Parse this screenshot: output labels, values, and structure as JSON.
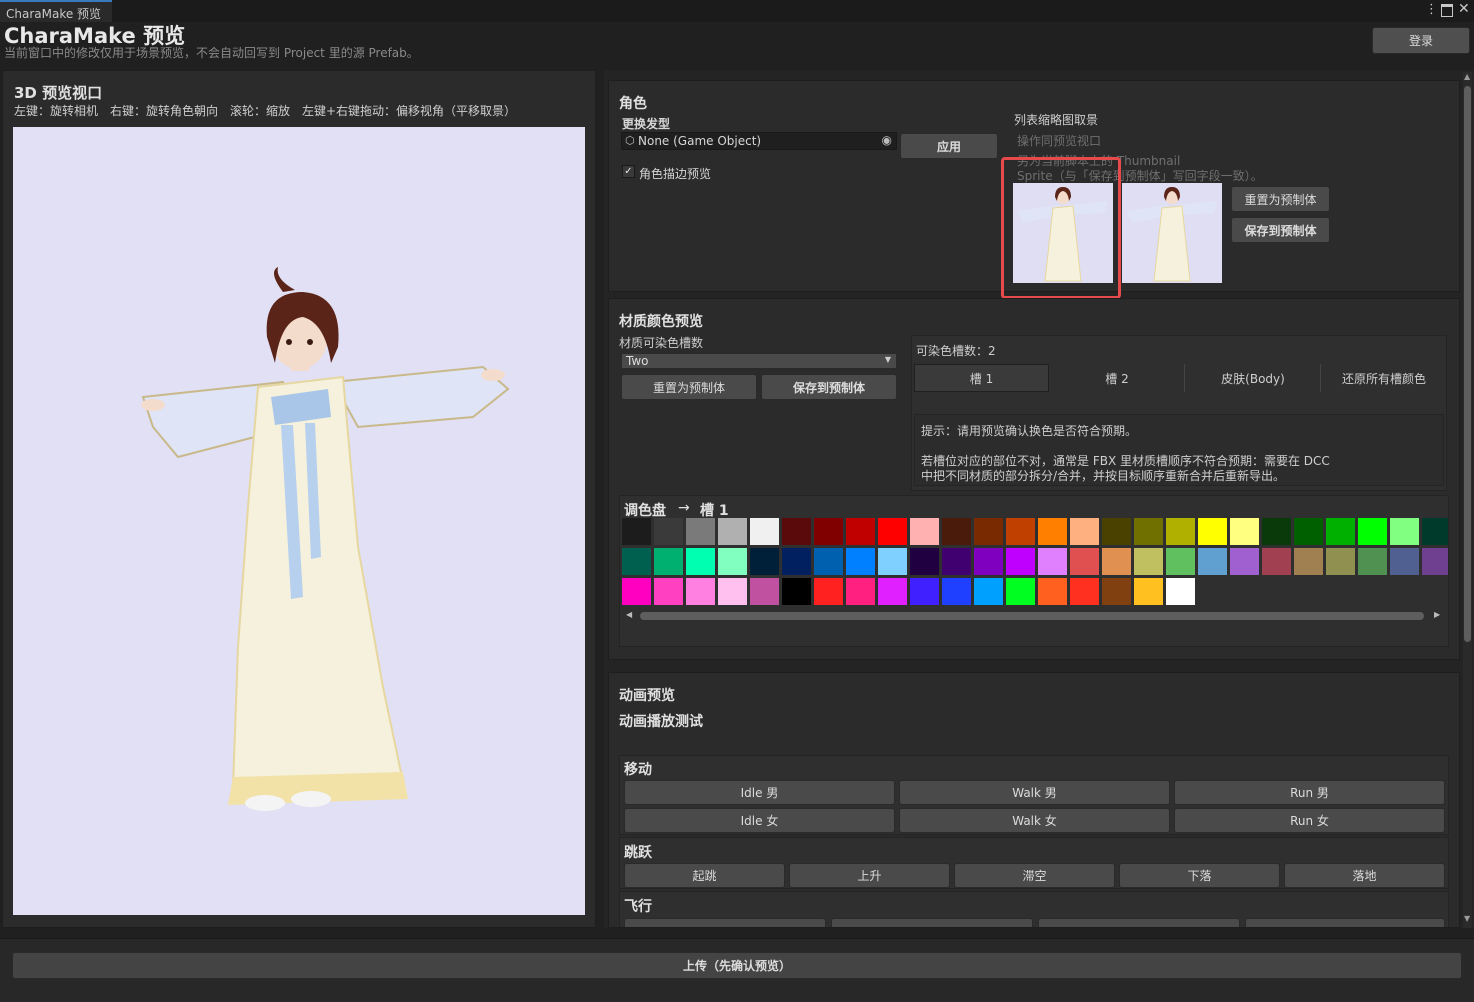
{
  "window": {
    "tab_title": "CharaMake 预览",
    "title": "CharaMake 预览",
    "subtitle": "当前窗口中的修改仅用于场景预览，不会自动回写到 Project 里的源 Prefab。",
    "login_label": "登录"
  },
  "viewport": {
    "title": "3D 预览视口",
    "hint": "左键：旋转相机　右键：旋转角色朝向　滚轮：缩放　左键+右键拖动：偏移视角（平移取景）"
  },
  "character": {
    "title": "角色",
    "hair_label": "更换发型",
    "hair_field_value": "None (Game Object)",
    "apply_label": "应用",
    "outline_label": "角色描边预览",
    "outline_checked": true,
    "thumb_title": "列表缩略图取景",
    "thumb_note1": "操作同预览视口",
    "thumb_note2": "另为当前脚本上的 Thumbnail",
    "thumb_note3": "Sprite（与「保存到预制体」写回字段一致）。",
    "reset_label": "重置为预制体",
    "save_label": "保存到预制体"
  },
  "material": {
    "title": "材质颜色预览",
    "slots_label": "材质可染色槽数",
    "slots_value": "Two",
    "reset_label": "重置为预制体",
    "save_label": "保存到预制体",
    "slot_count_text": "可染色槽数：2",
    "tabs": [
      "槽 1",
      "槽 2",
      "皮肤(Body)",
      "还原所有槽颜色"
    ],
    "tip1": "提示：请用预览确认换色是否符合预期。",
    "tip2": "若槽位对应的部位不对，通常是 FBX 里材质槽顺序不符合预期：需要在 DCC",
    "tip3": "中把不同材质的部分拆分/合并，并按目标顺序重新合并后重新导出。",
    "palette_title": "调色盘",
    "palette_target": "槽 1"
  },
  "palette": {
    "row1": [
      "#1c1c1c",
      "#3a3a3a",
      "#7a7a7a",
      "#b0b0b0",
      "#f0f0f0",
      "#5a0a0a",
      "#800000",
      "#c00000",
      "#ff0000",
      "#ffb0b0",
      "#4a1a0a",
      "#7a2a00",
      "#c04000",
      "#ff8000",
      "#ffb080",
      "#4a4000",
      "#707000",
      "#b0b000",
      "#ffff00",
      "#ffff80",
      "#0a3a0a",
      "#006000",
      "#00b000",
      "#00ff00",
      "#80ff80",
      "#003a2a"
    ],
    "row2": [
      "#006050",
      "#00b070",
      "#00ffb0",
      "#80ffc0",
      "#00203a",
      "#002060",
      "#0060b0",
      "#0080ff",
      "#80d0ff",
      "#200040",
      "#400070",
      "#8000c0",
      "#c000ff",
      "#e080ff",
      "#e05050",
      "#e09050",
      "#c0c060",
      "#60c060",
      "#60a0d0",
      "#a060d0",
      "#a04050",
      "#a08050",
      "#909050",
      "#509050",
      "#506090",
      "#704090"
    ],
    "row3": [
      "#ff00c0",
      "#ff40c0",
      "#ff80e0",
      "#ffc0f0",
      "#c050a0",
      "#000000",
      "#ff2020",
      "#ff2080",
      "#e020ff",
      "#4020ff",
      "#2040ff",
      "#00a0ff",
      "#00ff20",
      "#ff6020",
      "#ff3020",
      "#804010",
      "#ffc020",
      "#ffffff"
    ]
  },
  "animation": {
    "title": "动画预览",
    "subtitle": "动画播放测试",
    "move_title": "移动",
    "move_buttons": [
      "Idle 男",
      "Walk 男",
      "Run 男",
      "Idle 女",
      "Walk 女",
      "Run 女"
    ],
    "jump_title": "跳跃",
    "jump_buttons": [
      "起跳",
      "上升",
      "滞空",
      "下落",
      "落地"
    ],
    "fly_title": "飞行"
  },
  "footer": {
    "upload_label": "上传（先确认预览）"
  }
}
